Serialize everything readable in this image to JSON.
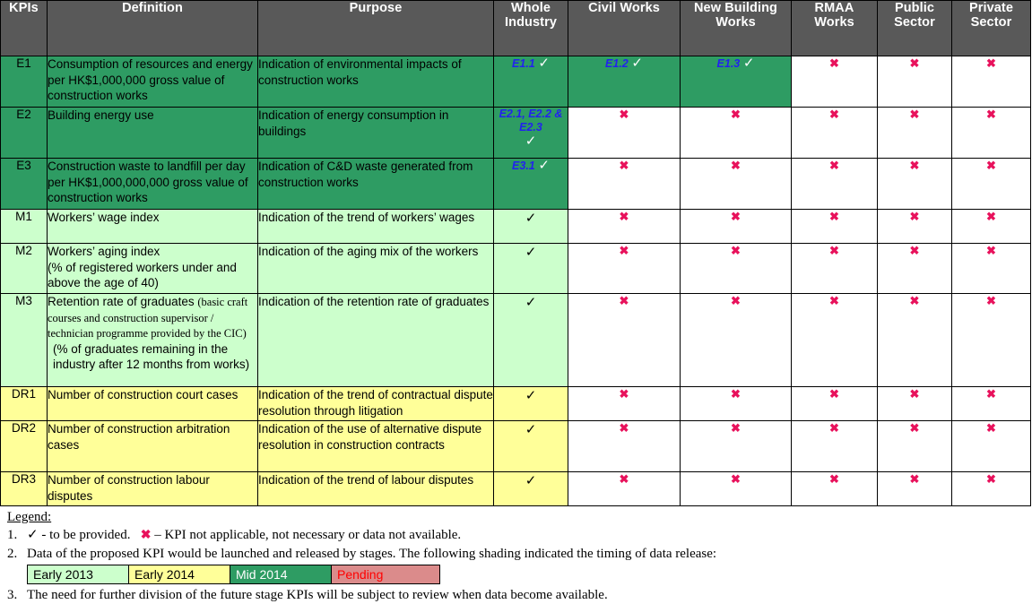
{
  "table": {
    "columns": [
      {
        "id": "kpis",
        "label": "KPIs"
      },
      {
        "id": "definition",
        "label": "Definition"
      },
      {
        "id": "purpose",
        "label": "Purpose"
      },
      {
        "id": "whole_industry",
        "label": "Whole\nIndustry",
        "line1": "Whole",
        "line2": "Industry"
      },
      {
        "id": "civil_works",
        "label": "Civil Works",
        "line1": "Civil Works",
        "line2": ""
      },
      {
        "id": "new_building_works",
        "label": "New Building Works",
        "line1": "New Building",
        "line2": "Works"
      },
      {
        "id": "rmaa_works",
        "label": "RMAA Works",
        "line1": "RMAA",
        "line2": "Works"
      },
      {
        "id": "public_sector",
        "label": "Public Sector",
        "line1": "Public",
        "line2": "Sector"
      },
      {
        "id": "private_sector",
        "label": "Private Sector",
        "line1": "Private",
        "line2": "Sector"
      }
    ],
    "rows": [
      {
        "code": "E1",
        "shade": "mid2014",
        "definition": "Consumption of resources and energy per HK$1,000,000 gross value of construction works",
        "purpose": "Indication of environmental impacts of construction works",
        "whole_industry": {
          "sub": "E1.1",
          "mark": "tick",
          "shade": "mid2014"
        },
        "civil_works": {
          "sub": "E1.2",
          "mark": "tick",
          "shade": "mid2014"
        },
        "new_building_works": {
          "sub": "E1.3",
          "mark": "tick",
          "shade": "mid2014"
        },
        "rmaa_works": {
          "sub": "",
          "mark": "cross",
          "shade": "white"
        },
        "public_sector": {
          "sub": "",
          "mark": "cross",
          "shade": "white"
        },
        "private_sector": {
          "sub": "",
          "mark": "cross",
          "shade": "white"
        }
      },
      {
        "code": "E2",
        "shade": "mid2014",
        "definition": "Building energy use",
        "purpose": "Indication of energy consumption in buildings",
        "whole_industry": {
          "sub": "E2.1, E2.2 & E2.3",
          "mark": "tick",
          "shade": "mid2014",
          "stacked": true
        },
        "civil_works": {
          "sub": "",
          "mark": "cross",
          "shade": "white"
        },
        "new_building_works": {
          "sub": "",
          "mark": "cross",
          "shade": "white"
        },
        "rmaa_works": {
          "sub": "",
          "mark": "cross",
          "shade": "white"
        },
        "public_sector": {
          "sub": "",
          "mark": "cross",
          "shade": "white"
        },
        "private_sector": {
          "sub": "",
          "mark": "cross",
          "shade": "white"
        }
      },
      {
        "code": "E3",
        "shade": "mid2014",
        "definition": "Construction waste to landfill per day per HK$1,000,000,000 gross value of construction works",
        "purpose": "Indication of C&D waste generated from construction works",
        "whole_industry": {
          "sub": "E3.1",
          "mark": "tick",
          "shade": "mid2014"
        },
        "civil_works": {
          "sub": "",
          "mark": "cross",
          "shade": "white"
        },
        "new_building_works": {
          "sub": "",
          "mark": "cross",
          "shade": "white"
        },
        "rmaa_works": {
          "sub": "",
          "mark": "cross",
          "shade": "white"
        },
        "public_sector": {
          "sub": "",
          "mark": "cross",
          "shade": "white"
        },
        "private_sector": {
          "sub": "",
          "mark": "cross",
          "shade": "white"
        }
      },
      {
        "code": "M1",
        "shade": "early2013",
        "definition": "Workers’ wage index",
        "purpose": "Indication of the trend of workers’ wages",
        "whole_industry": {
          "sub": "",
          "mark": "tick",
          "shade": "early2013"
        },
        "civil_works": {
          "sub": "",
          "mark": "cross",
          "shade": "white"
        },
        "new_building_works": {
          "sub": "",
          "mark": "cross",
          "shade": "white"
        },
        "rmaa_works": {
          "sub": "",
          "mark": "cross",
          "shade": "white"
        },
        "public_sector": {
          "sub": "",
          "mark": "cross",
          "shade": "white"
        },
        "private_sector": {
          "sub": "",
          "mark": "cross",
          "shade": "white"
        }
      },
      {
        "code": "M2",
        "shade": "early2013",
        "definition": "Workers’ aging index\n(% of registered workers under and above the age of 40)",
        "definition_line1": "Workers’ aging index",
        "definition_line2": "(% of registered workers under and above the age of 40)",
        "purpose": "Indication of the aging mix of the workers",
        "whole_industry": {
          "sub": "",
          "mark": "tick",
          "shade": "early2013"
        },
        "civil_works": {
          "sub": "",
          "mark": "cross",
          "shade": "white"
        },
        "new_building_works": {
          "sub": "",
          "mark": "cross",
          "shade": "white"
        },
        "rmaa_works": {
          "sub": "",
          "mark": "cross",
          "shade": "white"
        },
        "public_sector": {
          "sub": "",
          "mark": "cross",
          "shade": "white"
        },
        "private_sector": {
          "sub": "",
          "mark": "cross",
          "shade": "white"
        }
      },
      {
        "code": "M3",
        "shade": "early2013",
        "definition_part1": "Retention rate of graduates ",
        "definition_part2": "(basic craft courses and construction supervisor / technician programme provided by the CIC)",
        "definition_part3": "(% of graduates remaining in the industry after 12 months from works)",
        "purpose": "Indication of the retention rate of graduates",
        "whole_industry": {
          "sub": "",
          "mark": "tick",
          "shade": "early2013"
        },
        "civil_works": {
          "sub": "",
          "mark": "cross",
          "shade": "white"
        },
        "new_building_works": {
          "sub": "",
          "mark": "cross",
          "shade": "white"
        },
        "rmaa_works": {
          "sub": "",
          "mark": "cross",
          "shade": "white"
        },
        "public_sector": {
          "sub": "",
          "mark": "cross",
          "shade": "white"
        },
        "private_sector": {
          "sub": "",
          "mark": "cross",
          "shade": "white"
        }
      },
      {
        "code": "DR1",
        "shade": "early2014",
        "definition": "Number of construction court cases",
        "purpose": "Indication of the trend of contractual dispute resolution through litigation",
        "whole_industry": {
          "sub": "",
          "mark": "tick",
          "shade": "early2014"
        },
        "civil_works": {
          "sub": "",
          "mark": "cross",
          "shade": "white"
        },
        "new_building_works": {
          "sub": "",
          "mark": "cross",
          "shade": "white"
        },
        "rmaa_works": {
          "sub": "",
          "mark": "cross",
          "shade": "white"
        },
        "public_sector": {
          "sub": "",
          "mark": "cross",
          "shade": "white"
        },
        "private_sector": {
          "sub": "",
          "mark": "cross",
          "shade": "white"
        }
      },
      {
        "code": "DR2",
        "shade": "early2014",
        "definition": "Number of construction arbitration cases",
        "purpose": "Indication of the use of alternative dispute resolution in construction contracts",
        "whole_industry": {
          "sub": "",
          "mark": "tick",
          "shade": "early2014"
        },
        "civil_works": {
          "sub": "",
          "mark": "cross",
          "shade": "white"
        },
        "new_building_works": {
          "sub": "",
          "mark": "cross",
          "shade": "white"
        },
        "rmaa_works": {
          "sub": "",
          "mark": "cross",
          "shade": "white"
        },
        "public_sector": {
          "sub": "",
          "mark": "cross",
          "shade": "white"
        },
        "private_sector": {
          "sub": "",
          "mark": "cross",
          "shade": "white"
        }
      },
      {
        "code": "DR3",
        "shade": "early2014",
        "definition": "Number of construction labour disputes",
        "purpose": "Indication of the trend of labour disputes",
        "whole_industry": {
          "sub": "",
          "mark": "tick",
          "shade": "early2014"
        },
        "civil_works": {
          "sub": "",
          "mark": "cross",
          "shade": "white"
        },
        "new_building_works": {
          "sub": "",
          "mark": "cross",
          "shade": "white"
        },
        "rmaa_works": {
          "sub": "",
          "mark": "cross",
          "shade": "white"
        },
        "public_sector": {
          "sub": "",
          "mark": "cross",
          "shade": "white"
        },
        "private_sector": {
          "sub": "",
          "mark": "cross",
          "shade": "white"
        }
      }
    ]
  },
  "legend": {
    "title": "Legend:",
    "item1_num": "1.",
    "item1_text_a": "- to be provided.",
    "item1_text_b": "– KPI not applicable, not necessary or data not available.",
    "item2_num": "2.",
    "item2_text": "Data of the proposed KPI would be launched and released by stages. The following shading indicated the timing of data release:",
    "item3_num": "3.",
    "item3_text": "The need for further division of the future stage KPIs will be subject to review when data become available.",
    "swatches": [
      {
        "label": "Early 2013",
        "color": "#CCFFCC",
        "text_color": "#000000"
      },
      {
        "label": "Early 2014",
        "color": "#FFFF99",
        "text_color": "#000000"
      },
      {
        "label": "Mid 2014",
        "color": "#2E9C63",
        "text_color": "#FFFFFF"
      },
      {
        "label": "Pending",
        "color": "#DB8B8B",
        "text_color": "#FF0000"
      }
    ]
  },
  "symbols": {
    "tick": "✓",
    "cross": "✖"
  },
  "colors": {
    "header_bg": "#595959",
    "mid_2014": "#2E9C63",
    "early_2013": "#CCFFCC",
    "early_2014": "#FFFF99",
    "pending": "#DB8B8B",
    "sub_code": "#2222EE",
    "cross": "#E8125C"
  }
}
